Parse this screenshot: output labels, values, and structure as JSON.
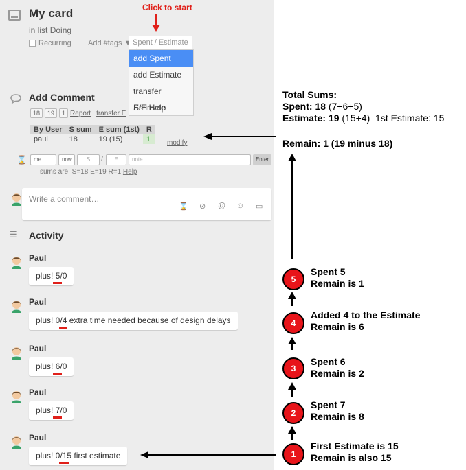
{
  "annotation": {
    "click_to_start": "Click to start"
  },
  "card": {
    "title": "My card",
    "in_list_prefix": "in list",
    "list_name": "Doing",
    "recurring_label": "Recurring",
    "tags_label": "Add #tags ▼",
    "se_select_label": "Spent / Estimate ▲",
    "dropdown_items": [
      "add Spent",
      "add Estimate",
      "transfer Estimate",
      "S/E Help"
    ]
  },
  "add_comment": {
    "title": "Add Comment",
    "badges": [
      "18",
      "19",
      "1"
    ],
    "report_link": "Report",
    "transfer_link": "transfer E"
  },
  "sums_table": {
    "headers": [
      "By User",
      "S sum",
      "E sum (1st)",
      "R"
    ],
    "row": {
      "user": "paul",
      "s_sum": "18",
      "e_sum": "19 (15)",
      "r": "1"
    },
    "modify_link": "modify"
  },
  "entry": {
    "me": "me",
    "now": "now",
    "s_placeholder": "S",
    "slash": "/",
    "e_placeholder": "E",
    "note_placeholder": "note",
    "enter": "Enter",
    "sums_text": "sums are:  S=18     E=19    R=1",
    "help_link": "Help"
  },
  "comment_box": {
    "placeholder": "Write a comment…"
  },
  "activity": {
    "title": "Activity",
    "items": [
      {
        "user": "Paul",
        "prefix": "plus! ",
        "value": "5/0",
        "suffix": ""
      },
      {
        "user": "Paul",
        "prefix": "plus! 0/",
        "value": "4",
        "suffix": " extra time needed because of design delays"
      },
      {
        "user": "Paul",
        "prefix": "plus! ",
        "value": "6/0",
        "suffix": ""
      },
      {
        "user": "Paul",
        "prefix": "plus! ",
        "value": "7/0",
        "suffix": ""
      },
      {
        "user": "Paul",
        "prefix": "plus! 0/",
        "value": "15",
        "suffix": " first estimate"
      }
    ]
  },
  "explanation": {
    "totals_title": "Total Sums:",
    "spent_label": "Spent:",
    "spent_value": "18",
    "spent_detail": "(7+6+5)",
    "estimate_label": "Estimate:",
    "estimate_value": "19",
    "estimate_detail": "(15+4)",
    "first_estimate": "1st Estimate: 15",
    "remain": "Remain: 1 (19 minus 18)",
    "steps": [
      {
        "num": "5",
        "line1": "Spent 5",
        "line2": "Remain is 1"
      },
      {
        "num": "4",
        "line1": "Added 4 to the Estimate",
        "line2": "Remain is 6"
      },
      {
        "num": "3",
        "line1": "Spent 6",
        "line2": "Remain is 2"
      },
      {
        "num": "2",
        "line1": "Spent 7",
        "line2": "Remain is 8"
      },
      {
        "num": "1",
        "line1": "First Estimate is 15",
        "line2": "Remain is also 15"
      }
    ]
  },
  "colors": {
    "panel_bg": "#ededed",
    "accent_blue": "#4a8ef5",
    "annotation_red": "#e0201a",
    "remain_green": "#d7ebd1"
  }
}
